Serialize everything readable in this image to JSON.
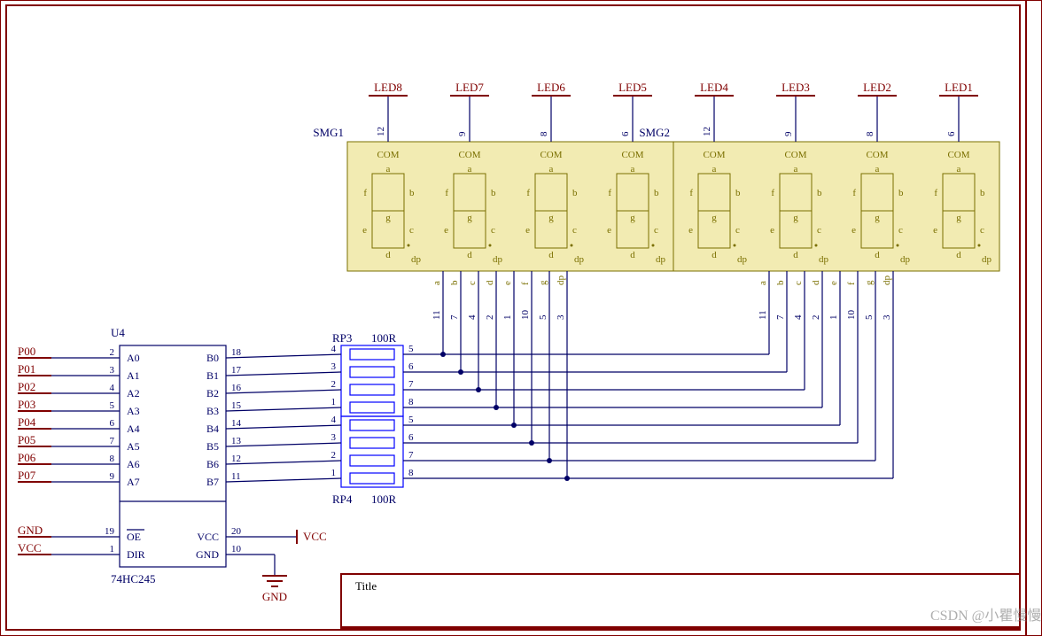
{
  "watermark": "CSDN @小瞿慢慢跑",
  "leds": {
    "net_labels": [
      "LED8",
      "LED7",
      "LED6",
      "LED5",
      "LED4",
      "LED3",
      "LED2",
      "LED1"
    ],
    "top_pin_nums": [
      "12",
      "9",
      "8",
      "6",
      "12",
      "9",
      "8",
      "6"
    ],
    "com_label": "COM",
    "seg_labels": {
      "a": "a",
      "b": "b",
      "c": "c",
      "d": "d",
      "e": "e",
      "f": "f",
      "g": "g",
      "dp": "dp"
    },
    "bottom_pin_letters": [
      "a",
      "b",
      "c",
      "d",
      "e",
      "f",
      "g",
      "dp"
    ],
    "bottom_pin_nums": [
      "11",
      "7",
      "4",
      "2",
      "1",
      "10",
      "5",
      "3"
    ]
  },
  "smg1_label": "SMG1",
  "smg2_label": "SMG2",
  "u4": {
    "ref": "U4",
    "part": "74HC245",
    "left_nets": [
      "P00",
      "P01",
      "P02",
      "P03",
      "P04",
      "P05",
      "P06",
      "P07"
    ],
    "left_nums": [
      "2",
      "3",
      "4",
      "5",
      "6",
      "7",
      "8",
      "9"
    ],
    "left_inner": [
      "A0",
      "A1",
      "A2",
      "A3",
      "A4",
      "A5",
      "A6",
      "A7"
    ],
    "right_inner": [
      "B0",
      "B1",
      "B2",
      "B3",
      "B4",
      "B5",
      "B6",
      "B7"
    ],
    "right_nums": [
      "18",
      "17",
      "16",
      "15",
      "14",
      "13",
      "12",
      "11"
    ],
    "oe": "OE",
    "dir": "DIR",
    "vcc": "VCC",
    "gnd_inner": "GND",
    "oe_num": "19",
    "dir_num": "1",
    "vcc_num": "20",
    "gnd_num": "10"
  },
  "rp3": {
    "ref": "RP3",
    "val": "100R",
    "left_nums": [
      "4",
      "3",
      "2",
      "1"
    ],
    "right_nums": [
      "5",
      "6",
      "7",
      "8"
    ]
  },
  "rp4": {
    "ref": "RP4",
    "val": "100R",
    "left_nums": [
      "4",
      "3",
      "2",
      "1"
    ],
    "right_nums": [
      "5",
      "6",
      "7",
      "8"
    ]
  },
  "gnd_net": "GND",
  "vcc_net": "VCC",
  "gnd_sym": "GND",
  "title_label": "Title"
}
